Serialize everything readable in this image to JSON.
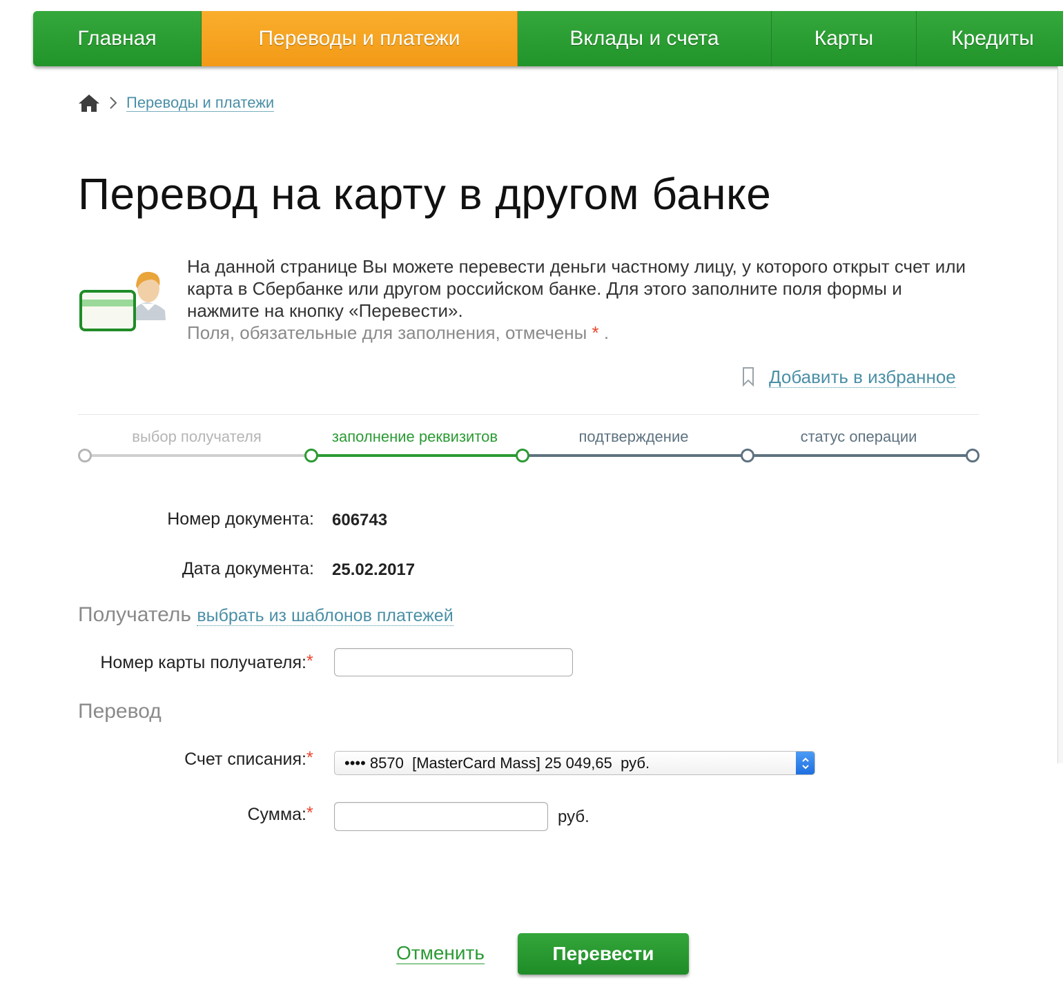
{
  "nav": {
    "tabs": [
      {
        "label": "Главная"
      },
      {
        "label": "Переводы и платежи",
        "active": true
      },
      {
        "label": "Вклады и счета"
      },
      {
        "label": "Карты"
      },
      {
        "label": "Кредиты"
      }
    ]
  },
  "breadcrumb": {
    "home_icon": "home-icon",
    "separator_icon": "chevron-right-icon",
    "link": "Переводы и платежи"
  },
  "page": {
    "title": "Перевод на карту в другом банке",
    "intro": "На данной странице Вы можете перевести деньги частному лицу, у которого открыт счет или карта в Сбербанке или другом российском банке. Для этого заполните поля формы и нажмите на кнопку «Перевести».",
    "required_hint": "Поля, обязательные для заполнения, отмечены",
    "required_mark": "*",
    "required_hint_end": " .",
    "favorite": "Добавить в избранное"
  },
  "steps": [
    {
      "label": "выбор получателя",
      "state": "done"
    },
    {
      "label": "заполнение реквизитов",
      "state": "current"
    },
    {
      "label": "подтверждение",
      "state": "pending"
    },
    {
      "label": "статус операции",
      "state": "pending"
    }
  ],
  "document": {
    "number_label": "Номер документа:",
    "number_value": "606743",
    "date_label": "Дата документа:",
    "date_value": "25.02.2017"
  },
  "recipient": {
    "section_title": "Получатель",
    "template_link": "выбрать из шаблонов платежей",
    "card_label": "Номер карты получателя:",
    "card_value": "",
    "card_placeholder": ""
  },
  "transfer": {
    "section_title": "Перевод",
    "account_label": "Счет списания:",
    "account_selected": "•••• 8570  [MasterCard Mass] 25 049,65  руб.",
    "amount_label": "Сумма:",
    "amount_value": "",
    "amount_unit": "руб."
  },
  "actions": {
    "cancel": "Отменить",
    "submit": "Перевести"
  },
  "colors": {
    "brand_green": "#21942a",
    "active_orange": "#f5a21f",
    "link_blue": "#4a8fa6",
    "required_red": "#e8452c"
  }
}
